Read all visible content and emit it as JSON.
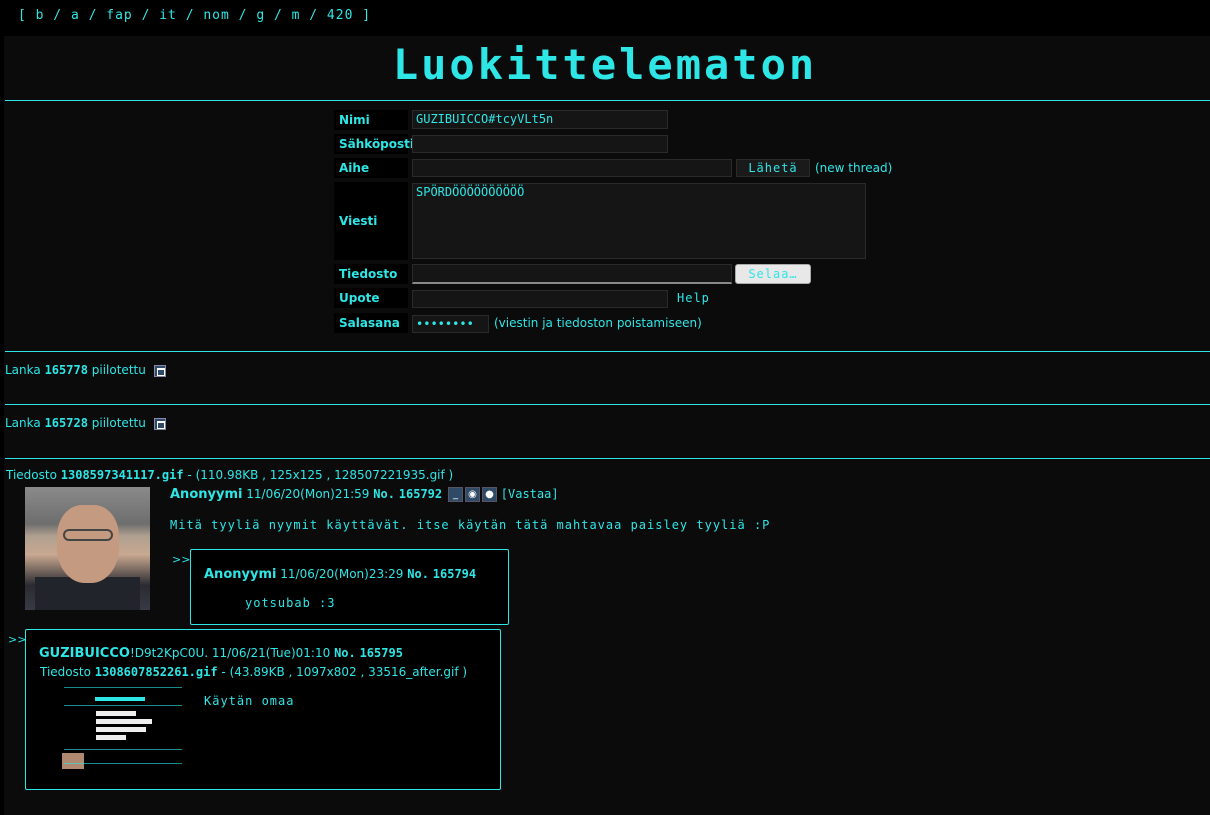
{
  "nav": {
    "boards": "[ b / a / fap / it / nom / g / m / 420 ]"
  },
  "board": {
    "title": "Luokittelematon"
  },
  "form": {
    "name_label": "Nimi",
    "name_value": "GUZIBUICCO#tcyVLt5n",
    "email_label": "Sähköposti",
    "email_value": "",
    "subject_label": "Aihe",
    "subject_value": "",
    "submit_label": "Lähetä",
    "submit_note": "(new thread)",
    "message_label": "Viesti",
    "message_value": "SPÖRDÖÖÖÖÖÖÖÖÖÖ",
    "file_label": "Tiedosto",
    "browse_label": "Selaa…",
    "embed_label": "Upote",
    "embed_value": "",
    "help_label": "Help",
    "password_label": "Salasana",
    "password_value": "••••••••",
    "password_note": "(viestin ja tiedoston poistamiseen)"
  },
  "hidden_threads": [
    {
      "prefix": "Lanka",
      "number": "165778",
      "suffix": "piilotettu"
    },
    {
      "prefix": "Lanka",
      "number": "165728",
      "suffix": "piilotettu"
    }
  ],
  "thread": {
    "file_prefix": "Tiedosto",
    "file_name": "1308597341117.gif",
    "file_meta": "- (110.98KB , 125x125 , 128507221935.gif )",
    "op": {
      "name": "Anonyymi",
      "date": "11/06/20(Mon)21:59",
      "no_label": "No.",
      "number": "165792",
      "reply_label": "[Vastaa]",
      "text": "Mitä tyyliä nyymit käyttävät. itse käytän tätä mahtavaa paisley tyyliä :P"
    },
    "replies": [
      {
        "arrow": ">>",
        "name": "Anonyymi",
        "date": "11/06/20(Mon)23:29",
        "no_label": "No.",
        "number": "165794",
        "text": "yotsubab :3"
      },
      {
        "arrow": ">>",
        "name": "GUZIBUICCO",
        "trip": "!D9t2KpC0U.",
        "date": "11/06/21(Tue)01:10",
        "no_label": "No.",
        "number": "165795",
        "file_prefix": "Tiedosto",
        "file_name": "1308607852261.gif",
        "file_meta": "- (43.89KB , 1097x802 , 33516_after.gif )",
        "text": "Käytän omaa"
      }
    ]
  },
  "colors": {
    "accent": "#2ee6e6",
    "background": "#0b0b0b"
  }
}
